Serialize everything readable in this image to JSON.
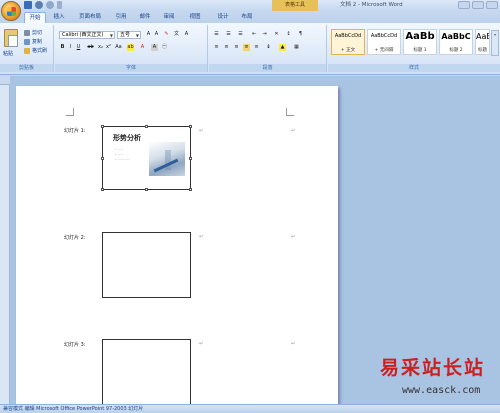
{
  "app": {
    "window_title": "文档 2 - Microsoft Word",
    "context_tab": "表格工具"
  },
  "tabs": [
    "开始",
    "插入",
    "页面布局",
    "引用",
    "邮件",
    "审阅",
    "视图",
    "设计",
    "布局"
  ],
  "ribbon": {
    "clipboard": {
      "label": "剪贴板",
      "paste": "粘贴",
      "cut": "剪切",
      "copy": "复制",
      "format_painter": "格式刷"
    },
    "font": {
      "label": "字体",
      "font_name": "Calibri (西文正文)",
      "font_size": "五号"
    },
    "paragraph": {
      "label": "段落"
    },
    "styles": {
      "label": "样式",
      "items": [
        {
          "sample": "AaBbCcDd",
          "name": "+ 正文"
        },
        {
          "sample": "AaBbCcDd",
          "name": "+ 无间隔"
        },
        {
          "sample": "AaBb",
          "name": "标题 1"
        },
        {
          "sample": "AaBbC",
          "name": "标题 2"
        },
        {
          "sample": "AaBbC",
          "name": "标题"
        }
      ]
    }
  },
  "document": {
    "slides": [
      {
        "label": "幻灯片 1:",
        "title": "形势分析",
        "bullets": [
          "• ——",
          "• ——",
          "• ————"
        ]
      },
      {
        "label": "幻灯片 2:"
      },
      {
        "label": "幻灯片 3:"
      }
    ],
    "para_mark": "↵"
  },
  "status_bar": "兼容模式 编辑 Microsoft Office PowerPoint 97-2003 幻灯片",
  "watermark": {
    "cn": "易采站长站",
    "url": "www.easck.com"
  },
  "colors": {
    "accent": "#15428b",
    "ribbon": "#dfeaf8",
    "watermark": "#cc1f1f"
  }
}
